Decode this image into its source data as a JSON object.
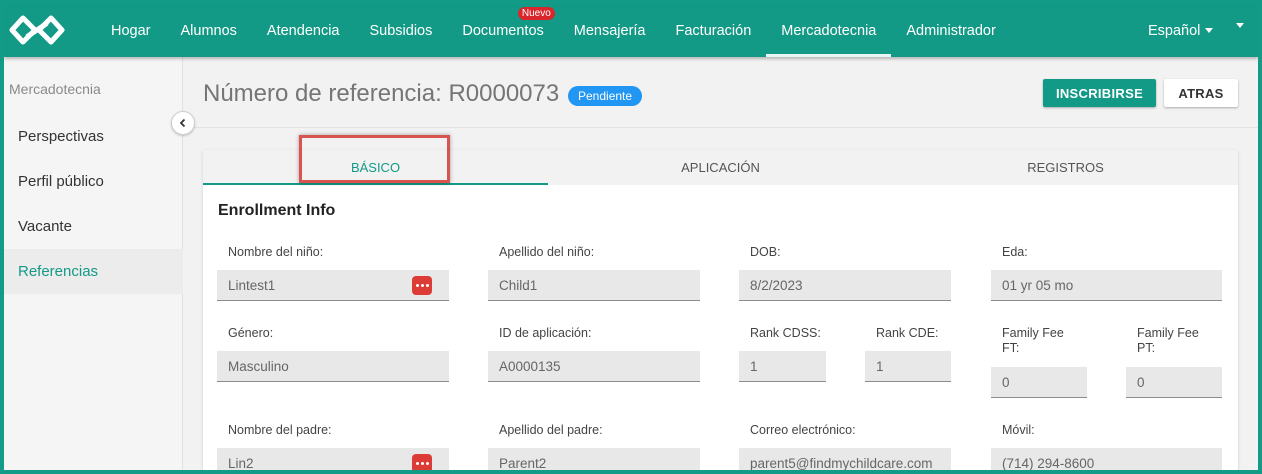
{
  "nav": {
    "items": [
      {
        "label": "Hogar"
      },
      {
        "label": "Alumnos"
      },
      {
        "label": "Atendencia"
      },
      {
        "label": "Subsidios"
      },
      {
        "label": "Documentos",
        "badge": "Nuevo"
      },
      {
        "label": "Mensajería"
      },
      {
        "label": "Facturación"
      },
      {
        "label": "Mercadotecnia",
        "active": true
      },
      {
        "label": "Administrador"
      }
    ],
    "language": "Español"
  },
  "sidebar": {
    "title": "Mercadotecnia",
    "items": [
      {
        "label": "Perspectivas"
      },
      {
        "label": "Perfil público"
      },
      {
        "label": "Vacante"
      },
      {
        "label": "Referencias",
        "active": true
      }
    ]
  },
  "header": {
    "title": "Número de referencia: R0000073",
    "status": "Pendiente",
    "enroll_label": "INSCRIBIRSE",
    "back_label": "ATRAS"
  },
  "tabs": [
    {
      "label": "BÁSICO",
      "active": true
    },
    {
      "label": "APLICACIÓN"
    },
    {
      "label": "REGISTROS"
    }
  ],
  "section_title": "Enrollment Info",
  "fields": {
    "child_first_name": {
      "label": "Nombre del niño:",
      "value": "Lintest1"
    },
    "child_last_name": {
      "label": "Apellido del niño:",
      "value": "Child1"
    },
    "dob": {
      "label": "DOB:",
      "value": "8/2/2023"
    },
    "age": {
      "label": "Eda:",
      "value": "01 yr 05 mo"
    },
    "gender": {
      "label": "Género:",
      "value": "Masculino"
    },
    "application_id": {
      "label": "ID de aplicación:",
      "value": "A0000135"
    },
    "rank_cdss": {
      "label": "Rank CDSS:",
      "value": "1"
    },
    "rank_cde": {
      "label": "Rank CDE:",
      "value": "1"
    },
    "family_fee_ft": {
      "label1": "Family Fee",
      "label2": "FT:",
      "value": "0"
    },
    "family_fee_pt": {
      "label1": "Family Fee",
      "label2": "PT:",
      "value": "0"
    },
    "parent_first_name": {
      "label": "Nombre del padre:",
      "value": "Lin2"
    },
    "parent_last_name": {
      "label": "Apellido del padre:",
      "value": "Parent2"
    },
    "email": {
      "label": "Correo electrónico:",
      "value": "parent5@findmychildcare.com"
    },
    "mobile": {
      "label": "Móvil:",
      "value": "(714) 294-8600"
    }
  },
  "colors": {
    "brand": "#139a87",
    "badge": "#2196f3",
    "alert": "#dd3c36",
    "highlight": "#d9534f"
  }
}
